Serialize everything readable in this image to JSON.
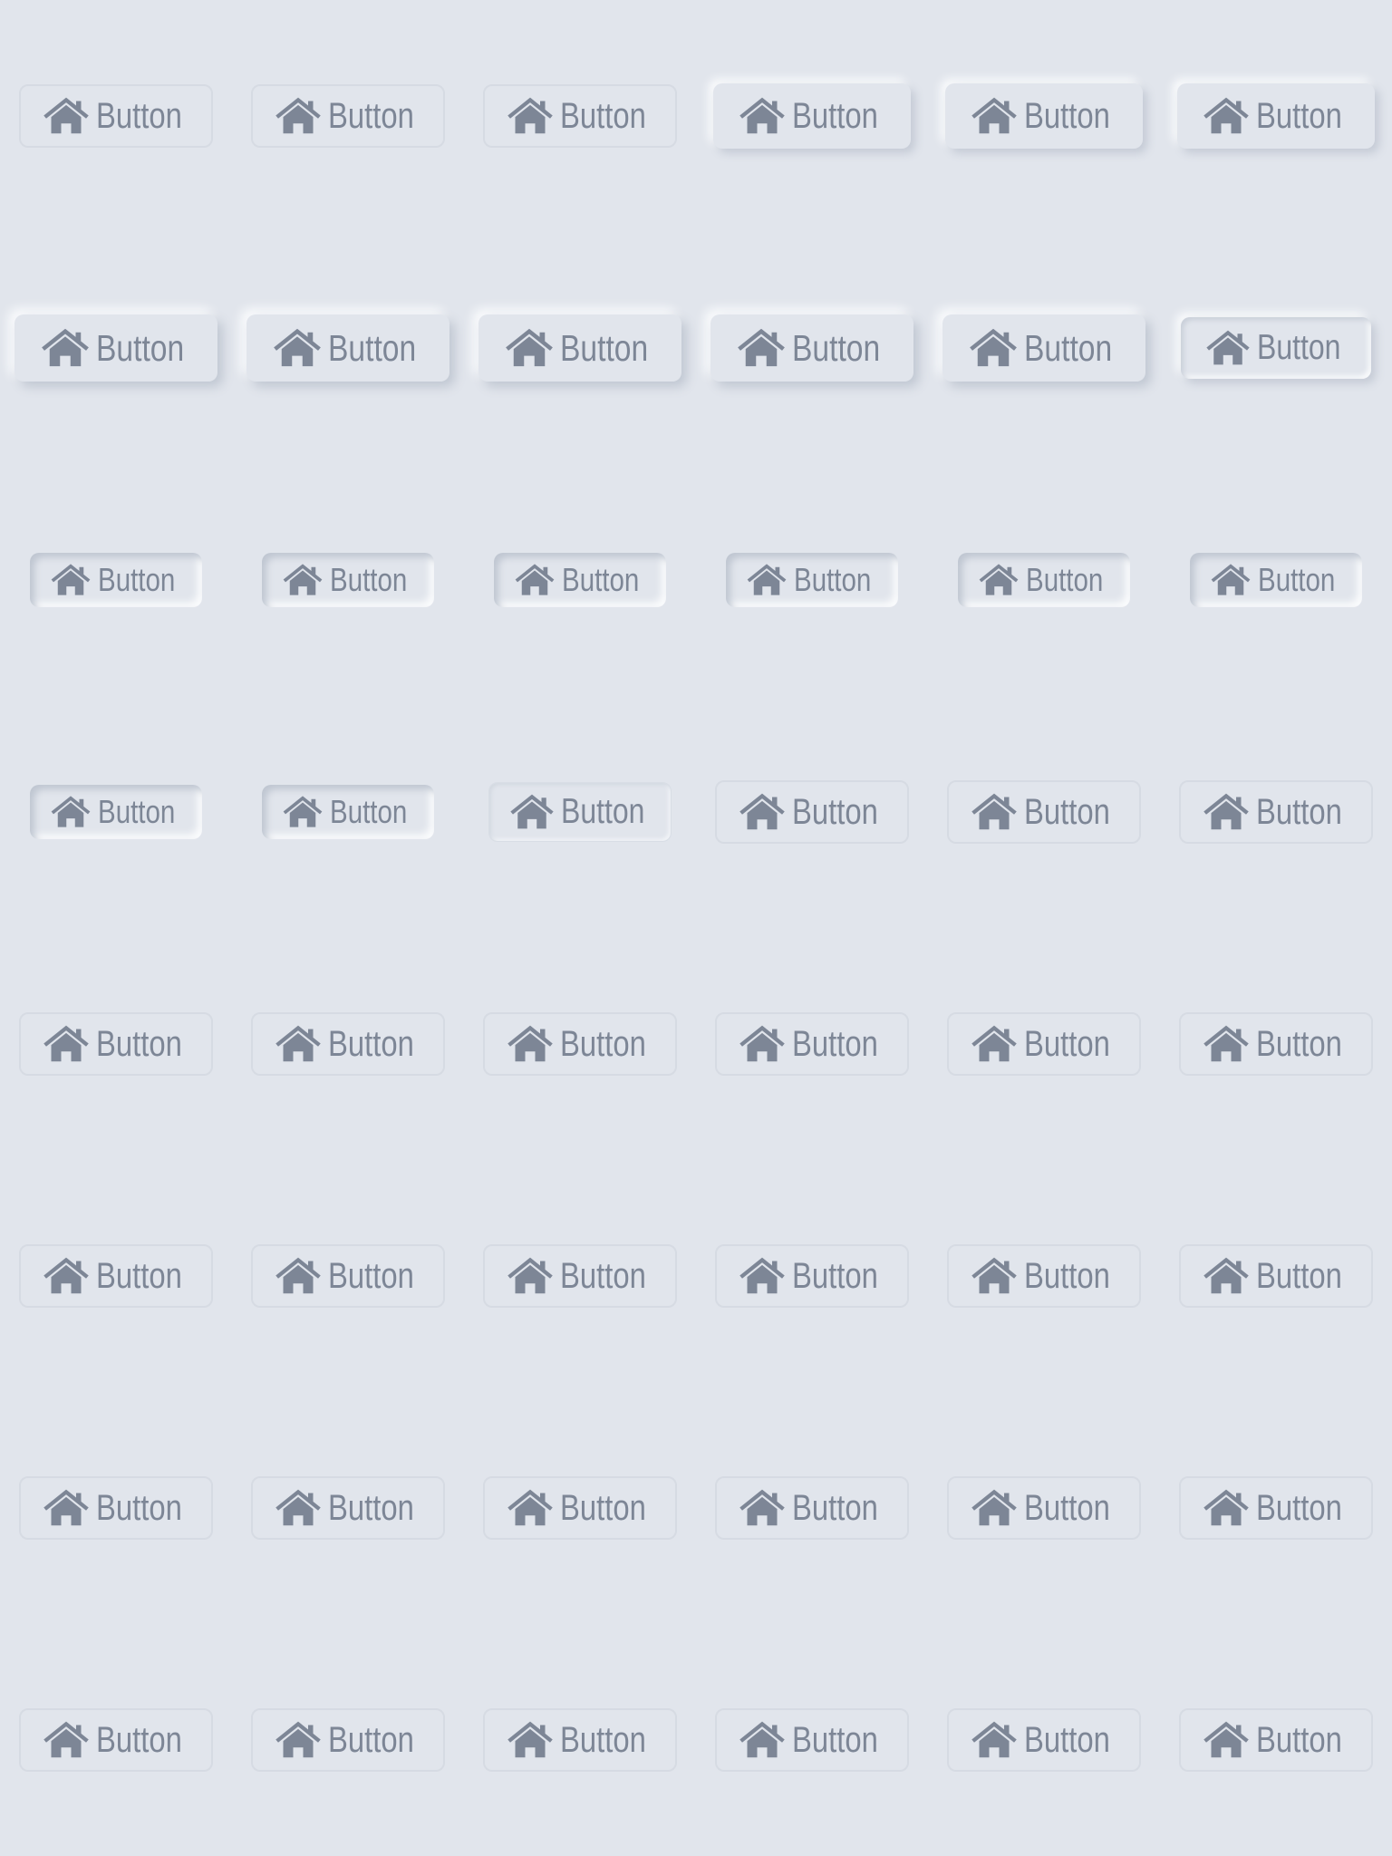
{
  "theme": {
    "background": "#e1e5ec",
    "text_color": "#7d8696",
    "light_shadow": "#fbfcfd",
    "dark_shadow": "#c0c7d2"
  },
  "buttons": {
    "label": "Button",
    "icon": "home-icon",
    "rows": [
      [
        "flat",
        "flat",
        "flat",
        "raised-soft",
        "raised-soft",
        "raised-soft"
      ],
      [
        "raised",
        "raised",
        "raised",
        "raised",
        "raised",
        "raised-inset"
      ],
      [
        "pressed",
        "pressed",
        "pressed",
        "pressed",
        "pressed",
        "pressed"
      ],
      [
        "pressed",
        "pressed",
        "soft-inset",
        "flat",
        "flat",
        "flat"
      ],
      [
        "flat",
        "flat",
        "flat",
        "flat",
        "flat",
        "flat"
      ],
      [
        "flat",
        "flat",
        "flat",
        "flat",
        "flat",
        "flat"
      ],
      [
        "flat",
        "flat",
        "flat",
        "flat",
        "flat",
        "flat"
      ],
      [
        "flat",
        "flat",
        "flat",
        "flat",
        "flat",
        "flat"
      ]
    ]
  }
}
